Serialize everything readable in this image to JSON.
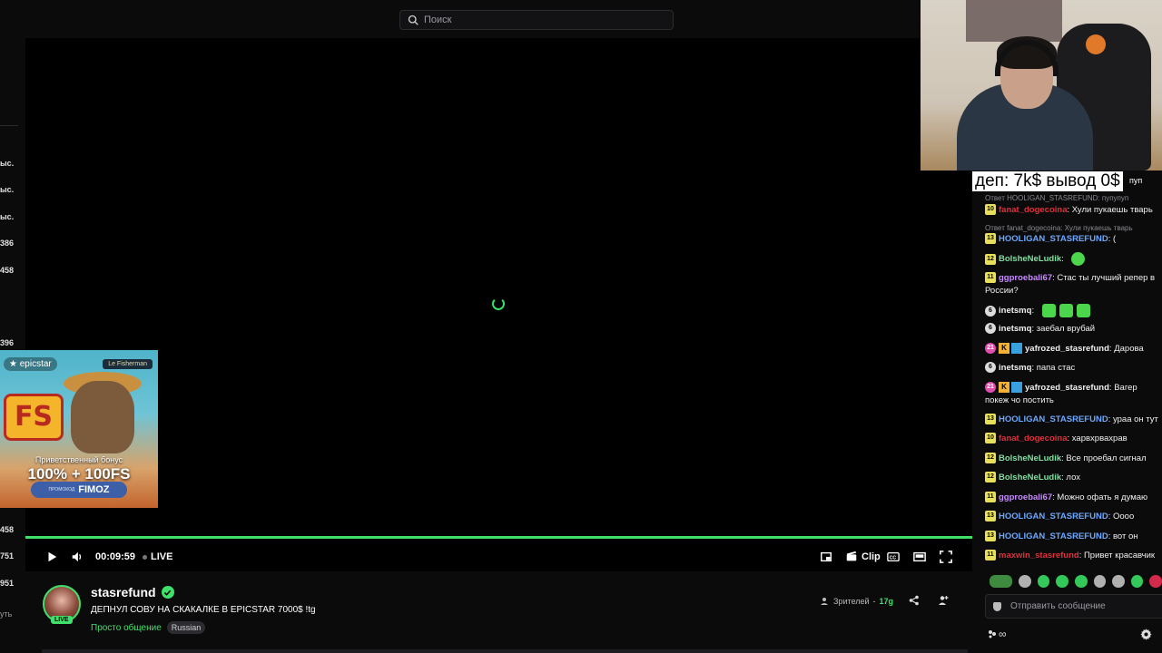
{
  "search": {
    "placeholder": "Поиск"
  },
  "left_column": {
    "numbers": [
      "ыс.",
      "ыс.",
      "ыс.",
      "386",
      "458",
      "396",
      "458",
      "751",
      "951",
      "уть"
    ]
  },
  "ad": {
    "brand": "epicstar",
    "partner": "Le Fisherman",
    "fs_text": "FS",
    "bonus_caption": "Приветственный бонус",
    "bonus_value": "100% + 100FS",
    "promo_label": "ПРОМОКОД",
    "promo_code": "FIMOZ"
  },
  "player": {
    "time": "00:09:59",
    "live_label": "LIVE",
    "clip_label": "Clip",
    "progress": 1.0,
    "accent": "#3fe16b"
  },
  "stream": {
    "channel": "stasrefund",
    "title": "ДЕПНУЛ СОВУ НА СКАКАЛКЕ В EPICSTAR 7000$ !tg",
    "category": "Просто общение",
    "language_tag": "Russian",
    "live_badge": "LIVE",
    "viewers_label": "Зрителей",
    "viewers_count": "17g"
  },
  "overlay": {
    "text": "деп: 7k$ вывод 0$",
    "tail": "пуп"
  },
  "chat": {
    "messages": [
      {
        "reply": "Ответ HOOLIGAN_STASREFUND: пупупуп"
      },
      {
        "level": "10",
        "user": "fanat_dogecoina",
        "color": "#e0303a",
        "text": ": Хули пукаешь тварь"
      },
      {
        "reply": "Ответ fanat_dogecoina: Хули пукаешь тварь"
      },
      {
        "level": "13",
        "user": "HOOLIGAN_STASREFUND",
        "color": "#6aa8ff",
        "text": ": ("
      },
      {
        "level": "12",
        "user": "BolsheNeLudik",
        "color": "#7fe0a0",
        "text": ":"
      },
      {
        "level": "11",
        "user": "ggproebali67",
        "color": "#c88cff",
        "text": ": Стас ты лучший репер в России?"
      },
      {
        "level": "6",
        "user": "inetsmq",
        "color": "#ffffff",
        "text": ":"
      },
      {
        "level": "6",
        "user": "inetsmq",
        "color": "#ffffff",
        "text": ": заебал врубай"
      },
      {
        "level": "21",
        "user": "yafrozed_stasrefund",
        "color": "#ffffff",
        "text": ": Дарова"
      },
      {
        "level": "6",
        "user": "inetsmq",
        "color": "#ffffff",
        "text": ": папа стас"
      },
      {
        "level": "21",
        "user": "yafrozed_stasrefund",
        "color": "#ffffff",
        "text": ": Вагер покеж чо постить"
      },
      {
        "level": "13",
        "user": "HOOLIGAN_STASREFUND",
        "color": "#6aa8ff",
        "text": ": ураа он тут"
      },
      {
        "level": "10",
        "user": "fanat_dogecoina",
        "color": "#e0303a",
        "text": ": харвхрвахрав"
      },
      {
        "level": "12",
        "user": "BolsheNeLudik",
        "color": "#7fe0a0",
        "text": ": Все проебал сигнал"
      },
      {
        "level": "12",
        "user": "BolsheNeLudik",
        "color": "#7fe0a0",
        "text": ": лох"
      },
      {
        "level": "11",
        "user": "ggproebali67",
        "color": "#c88cff",
        "text": ": Можно офать я думаю"
      },
      {
        "level": "13",
        "user": "HOOLIGAN_STASREFUND",
        "color": "#6aa8ff",
        "text": ": Оооо"
      },
      {
        "level": "13",
        "user": "HOOLIGAN_STASREFUND",
        "color": "#6aa8ff",
        "text": ": вот он"
      },
      {
        "level": "11",
        "user": "maxwin_stasrefund",
        "color": "#e0303a",
        "text": ": Привет красавчик"
      }
    ],
    "input_placeholder": "Отправить сообщение",
    "footer_symbol": "∞"
  }
}
